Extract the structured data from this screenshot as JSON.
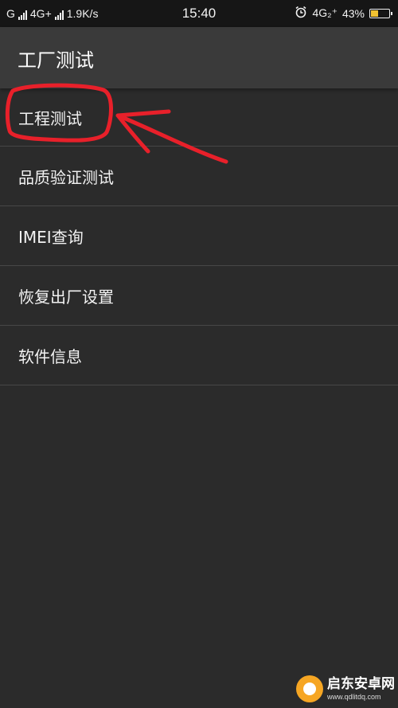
{
  "status_bar": {
    "carrier_left": "G",
    "network_type": "4G+",
    "speed": "1.9K/s",
    "time": "15:40",
    "network_right": "4G₂⁺",
    "battery_percent_text": "43%",
    "battery_level": 0.43,
    "battery_color": "#f1c232"
  },
  "header": {
    "title": "工厂测试"
  },
  "menu": {
    "items": [
      {
        "label": "工程测试"
      },
      {
        "label": "品质验证测试"
      },
      {
        "label": "IMEI查询"
      },
      {
        "label": "恢复出厂设置"
      },
      {
        "label": "软件信息"
      }
    ]
  },
  "annotation_color": "#e8202a",
  "watermark": {
    "name": "启东安卓网",
    "url": "www.qdlitdq.com"
  }
}
